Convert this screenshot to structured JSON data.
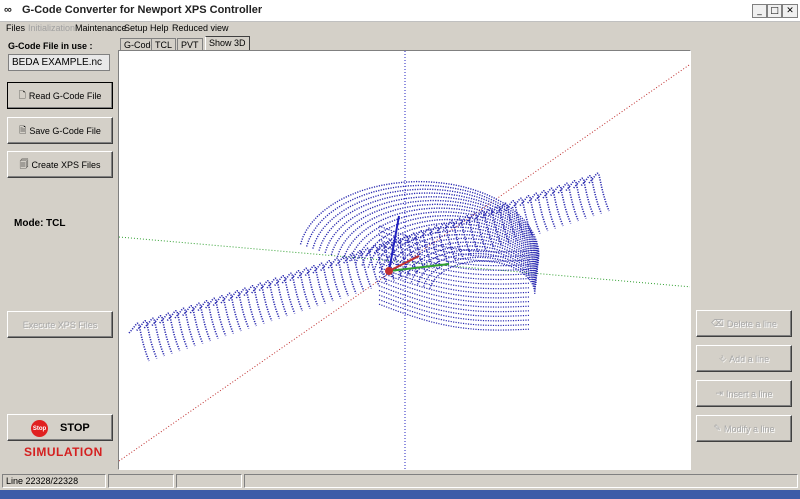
{
  "window": {
    "title": "G-Code Converter for Newport XPS Controller",
    "app_icon": "infinity-icon",
    "minimize_glyph": "_",
    "maximize_glyph": "□",
    "close_glyph": "✕"
  },
  "menu": {
    "items": [
      {
        "label": "Files",
        "enabled": true
      },
      {
        "label": "Initialization",
        "enabled": false
      },
      {
        "label": "Maintenance",
        "enabled": true
      },
      {
        "label": "Setup",
        "enabled": true
      },
      {
        "label": "Help",
        "enabled": true
      },
      {
        "label": "Reduced view",
        "enabled": true
      }
    ]
  },
  "left": {
    "file_label": "G-Code File in use :",
    "file_value": "BEDA EXAMPLE.nc",
    "read_button": "Read G-Code File",
    "save_button": "Save G-Code File",
    "create_button": "Create XPS Files",
    "mode_label": "Mode:",
    "mode_value": "TCL",
    "execute_button": "Execute XPS Files",
    "stop_sign_text": "Stop",
    "stop_label": "STOP",
    "simulation_label": "SIMULATION"
  },
  "tabs": [
    {
      "label": "G-Code",
      "active": false
    },
    {
      "label": "TCL",
      "active": false
    },
    {
      "label": "PVT",
      "active": false
    },
    {
      "label": "Show 3D",
      "active": true
    }
  ],
  "right": {
    "delete_button": "Delete a line",
    "add_button": "Add a line",
    "insert_button": "Insert a line",
    "modify_button": "Modify a line"
  },
  "status": {
    "line_counter": "Line 22328/22328",
    "cell2": "",
    "cell3": "",
    "cell4": ""
  },
  "colors": {
    "accent_red": "#d42020",
    "mesh_blue": "#2a2ab0",
    "axis_blue": "#2020c0",
    "axis_red": "#c03030",
    "axis_green": "#30a030"
  }
}
